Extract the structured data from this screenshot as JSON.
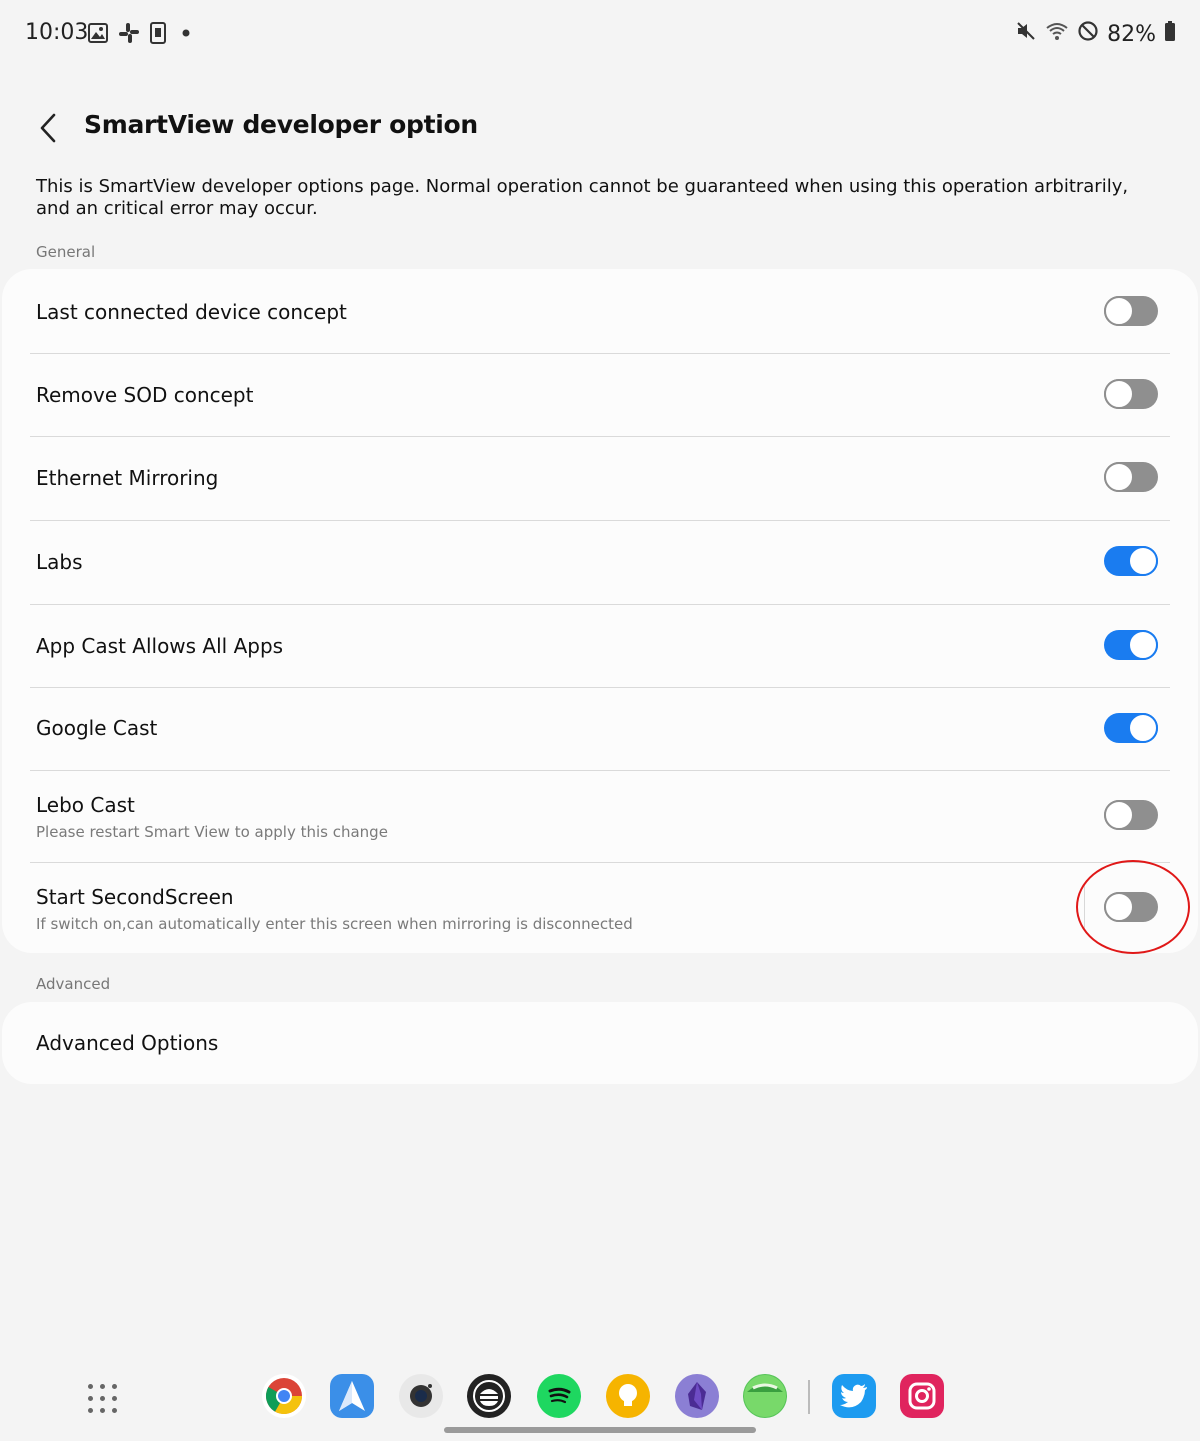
{
  "status_bar": {
    "time": "10:03",
    "battery": "82%",
    "left_icons": [
      "gallery-icon",
      "slack-icon",
      "phone-frame-icon",
      "dot-icon"
    ],
    "right_icons": [
      "mute-icon",
      "wifi-icon",
      "dnd-icon",
      "battery-icon"
    ]
  },
  "header": {
    "title": "SmartView developer option",
    "back_icon": "chevron-left-icon"
  },
  "description": "This is SmartView developer options page. Normal operation cannot be guaranteed when using this operation arbitrarily, and an critical error may occur.",
  "sections": {
    "general_label": "General",
    "advanced_label": "Advanced"
  },
  "general_items": [
    {
      "title": "Last connected device concept",
      "enabled": false
    },
    {
      "title": "Remove SOD concept",
      "enabled": false
    },
    {
      "title": "Ethernet Mirroring",
      "enabled": false
    },
    {
      "title": "Labs",
      "enabled": true
    },
    {
      "title": "App Cast Allows All Apps",
      "enabled": true
    },
    {
      "title": "Google Cast",
      "enabled": true
    },
    {
      "title": "Lebo Cast",
      "subtitle": "Please restart Smart View to apply this change",
      "enabled": false
    },
    {
      "title": "Start SecondScreen",
      "subtitle": "If switch on,can automatically enter this screen when mirroring is disconnected",
      "enabled": false
    }
  ],
  "advanced_items": [
    {
      "title": "Advanced Options"
    }
  ],
  "dock": {
    "apps": [
      "chrome-icon",
      "spark-mail-icon",
      "camera-icon",
      "hamburger-app-icon",
      "spotify-icon",
      "keep-bulb-icon",
      "obsidian-icon",
      "green-app-icon",
      "twitter-icon",
      "instagram-icon"
    ]
  },
  "colors": {
    "accent": "#1a7cf0",
    "toggle_off": "#8f8f8f",
    "highlight": "#e01818",
    "background": "#f4f4f4"
  }
}
